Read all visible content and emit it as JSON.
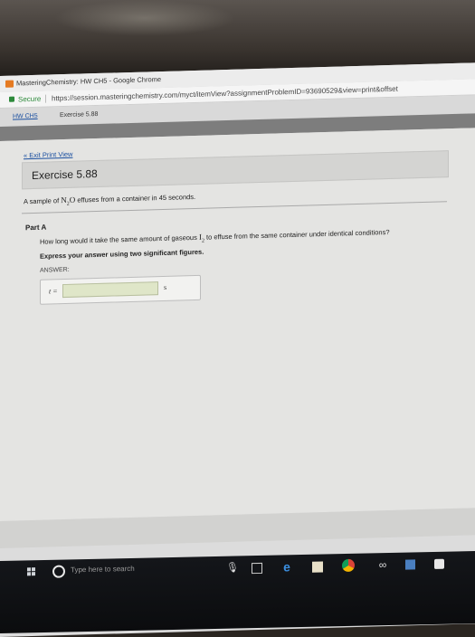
{
  "browser": {
    "window_title": "MasteringChemistry: HW CH5 - Google Chrome",
    "secure_label": "Secure",
    "url": "https://session.masteringchemistry.com/myct/itemView?assignmentProblemID=93690529&view=print&offset"
  },
  "breadcrumb": {
    "link": "HW CH5",
    "current": "Exercise 5.88"
  },
  "page": {
    "exit_link": "« Exit Print View",
    "exercise_title": "Exercise 5.88",
    "problem_prefix": "A sample of ",
    "problem_compound_main": "N",
    "problem_compound_sub": "2",
    "problem_compound_end": "O",
    "problem_suffix": " effuses from a container in 45 seconds.",
    "part_title": "Part A",
    "question_prefix": "How long would it take the same amount of gaseous ",
    "question_compound_main": "I",
    "question_compound_sub": "2",
    "question_suffix": " to effuse from the same container under identical conditions?",
    "instruction": "Express your answer using two significant figures.",
    "answer_label": "ANSWER:",
    "answer_variable": "t =",
    "answer_value": "",
    "answer_unit": "s"
  },
  "taskbar": {
    "search_placeholder": "Type here to search",
    "icons": [
      "windows-start-icon",
      "search-icon",
      "microphone-icon",
      "task-view-icon",
      "edge-icon",
      "store-icon",
      "chrome-icon",
      "infinity-icon",
      "app-icon",
      "app-icon"
    ]
  }
}
